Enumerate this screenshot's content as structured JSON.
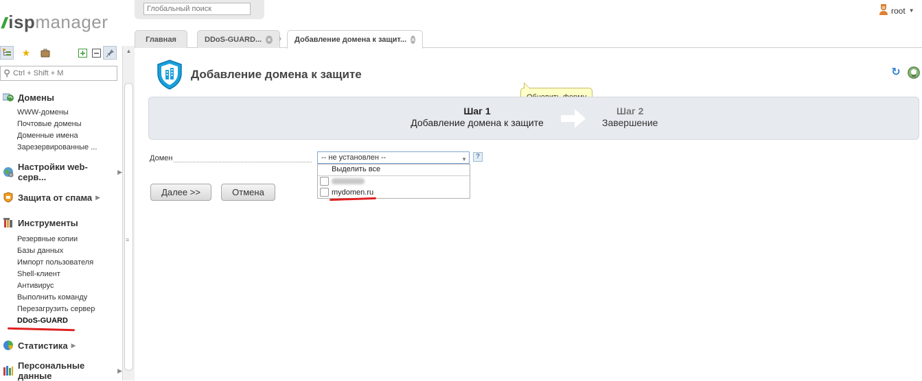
{
  "logo": {
    "prefix": "isp",
    "suffix": "manager"
  },
  "global_search": {
    "placeholder": "Глобальный поиск"
  },
  "user": {
    "name": "root"
  },
  "sidebar": {
    "search_placeholder": "Ctrl + Shift + M",
    "groups": [
      {
        "title": "Домены",
        "items": [
          "WWW-домены",
          "Почтовые домены",
          "Доменные имена",
          "Зарезервированные ..."
        ]
      },
      {
        "title": "Настройки web-серв...",
        "items": []
      },
      {
        "title": "Защита от спама",
        "items": []
      },
      {
        "title": "Инструменты",
        "items": [
          "Резервные копии",
          "Базы данных",
          "Импорт пользователя",
          "Shell-клиент",
          "Антивирус",
          "Выполнить команду",
          "Перезагрузить сервер",
          "DDoS-GUARD"
        ]
      },
      {
        "title": "Статистика",
        "items": []
      },
      {
        "title": "Персональные данные",
        "items": []
      }
    ]
  },
  "tabs": [
    {
      "label": "Главная",
      "closable": false
    },
    {
      "label": "DDoS-GUARD...",
      "closable": true
    },
    {
      "label": "Добавление домена к защит...",
      "closable": true
    }
  ],
  "form": {
    "title": "Добавление домена к защите",
    "tooltip": "Обновить форму",
    "steps": [
      {
        "num": "Шаг 1",
        "name": "Добавление домена к защите"
      },
      {
        "num": "Шаг 2",
        "name": "Завершение"
      }
    ],
    "field_label": "Домен",
    "select_value": "-- не установлен --",
    "help_mark": "?",
    "dropdown": {
      "select_all": "Выделить все",
      "options": [
        "mydomen.ru"
      ]
    },
    "buttons": {
      "next": "Далее >>",
      "cancel": "Отмена"
    }
  },
  "colors": {
    "accent_blue": "#2f7fd0",
    "highlight_red": "#e02020",
    "logo_green": "#3aa33a"
  }
}
